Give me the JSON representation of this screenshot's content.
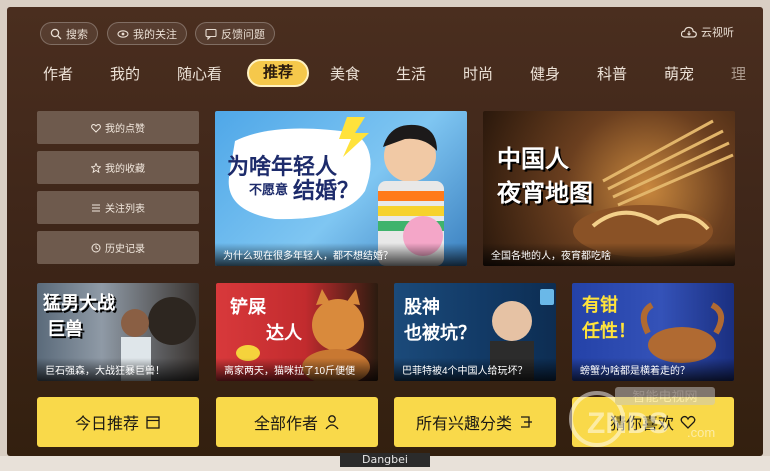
{
  "top_bar": {
    "search_label": "搜索",
    "follow_label": "我的关注",
    "feedback_label": "反馈问题",
    "cloud_label": "云视听"
  },
  "nav": {
    "tabs": [
      "作者",
      "我的",
      "随心看",
      "推荐",
      "美食",
      "生活",
      "时尚",
      "健身",
      "科普",
      "萌宠",
      "理"
    ],
    "active": "推荐"
  },
  "sidebar": {
    "items": [
      {
        "label": "我的点赞",
        "icon": "heart-icon"
      },
      {
        "label": "我的收藏",
        "icon": "star-icon"
      },
      {
        "label": "关注列表",
        "icon": "list-icon"
      },
      {
        "label": "历史记录",
        "icon": "clock-icon"
      }
    ]
  },
  "featured": [
    {
      "title_line1": "为啥年轻人",
      "title_line2a": "不愿意",
      "title_line2b": "结婚？",
      "caption": "为什么现在很多年轻人，都不想结婚？"
    },
    {
      "title_line1": "中国人",
      "title_line2": "夜宵地图",
      "caption": "全国各地的人，夜宵都吃啥"
    }
  ],
  "videos": [
    {
      "title_line1": "猛男大战",
      "title_line2": "巨兽",
      "caption": "巨石强森，大战狂暴巨兽！"
    },
    {
      "title_line1": "铲屎",
      "title_line2": "达人",
      "caption": "离家两天，猫咪拉了10斤便便"
    },
    {
      "title_line1": "股神",
      "title_line2": "也被坑？",
      "caption": "巴菲特被4个中国人给玩坏？"
    },
    {
      "title_line1": "有钳",
      "title_line2": "任性！",
      "caption": "螃蟹为啥都是横着走的？"
    }
  ],
  "bottom_buttons": [
    {
      "label": "今日推荐",
      "icon": "calendar-icon"
    },
    {
      "label": "全部作者",
      "icon": "person-icon"
    },
    {
      "label": "所有兴趣分类",
      "icon": "category-icon"
    },
    {
      "label": "猜你喜欢",
      "icon": "heart-icon"
    }
  ],
  "watermark": {
    "text": "智能电视网",
    "sub": "ZNDS",
    "domain": ".com"
  },
  "brand": "Dangbei",
  "colors": {
    "accent": "#f5c84b",
    "button_yellow": "#f9d94a",
    "background": "#3d2518"
  }
}
